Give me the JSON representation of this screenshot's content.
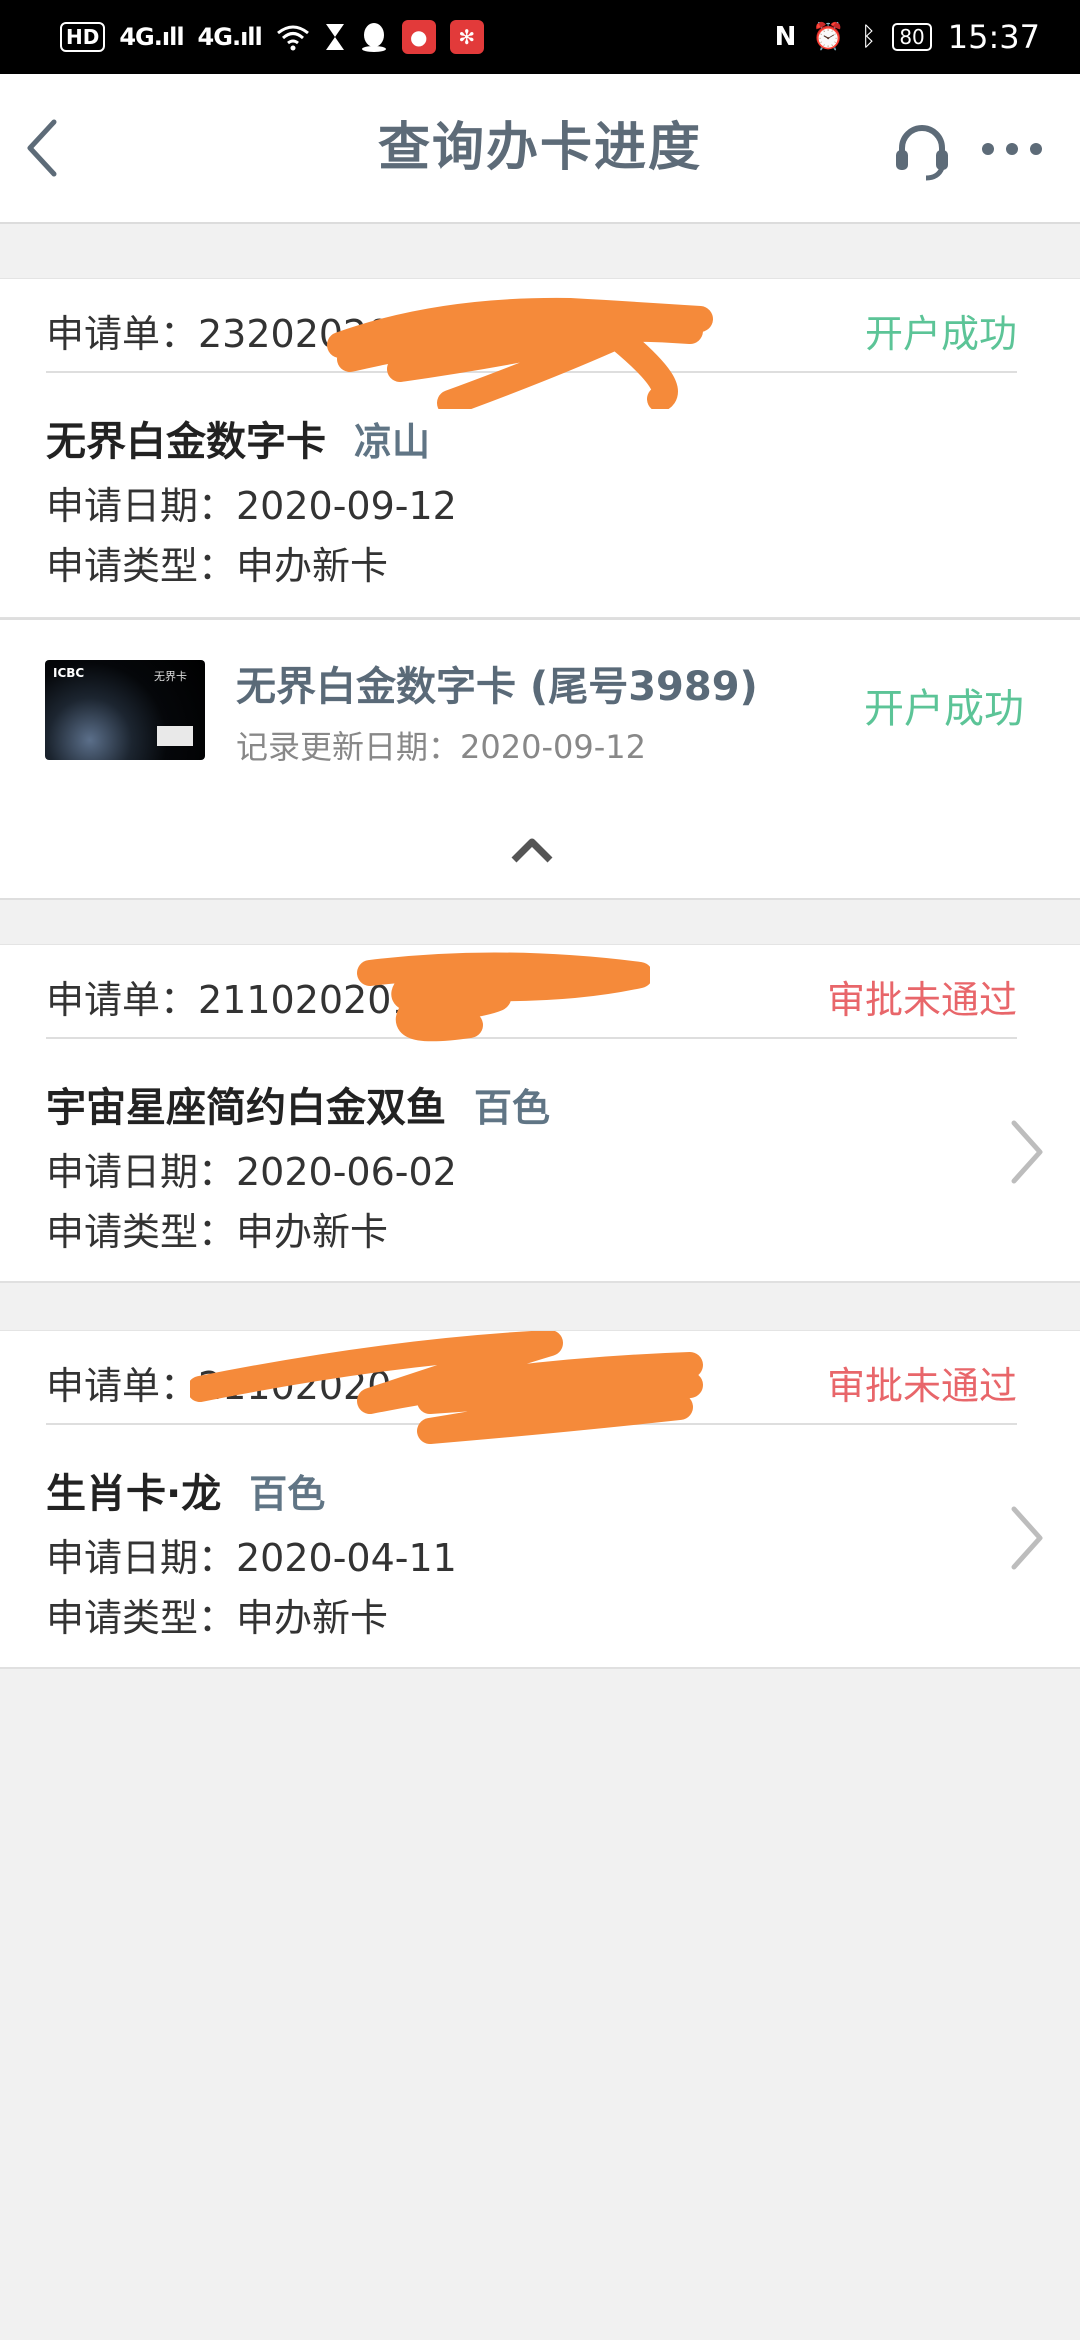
{
  "status_bar": {
    "hd": "HD",
    "sig1": "4G.ıll",
    "sig2": "4G.ıll",
    "battery": "80",
    "time": "15:37"
  },
  "header": {
    "title": "查询办卡进度"
  },
  "applications": [
    {
      "app_no": "申请单：232020200  901",
      "status": "开户成功",
      "card_name": "无界白金数字卡",
      "region": "凉山",
      "date": "申请日期：2020-09-12",
      "type": "申请类型：申办新卡",
      "detail": {
        "title": "无界白金数字卡 (尾号3989)",
        "update": "记录更新日期：2020-09-12",
        "status": "开户成功",
        "thumb_bank": "ICBC",
        "thumb_name": "无界卡"
      }
    },
    {
      "app_no": "申请单：211020201  7",
      "status": "审批未通过",
      "card_name": "宇宙星座简约白金双鱼",
      "region": "百色",
      "date": "申请日期：2020-06-02",
      "type": "申请类型：申办新卡"
    },
    {
      "app_no": "申请单：21102020",
      "status": "审批未通过",
      "card_name": "生肖卡·龙",
      "region": "百色",
      "date": "申请日期：2020-04-11",
      "type": "申请类型：申办新卡"
    }
  ],
  "colors": {
    "success": "#5cc497",
    "fail": "#e8666a",
    "title": "#5d6b78",
    "scribble": "#f58a3a"
  }
}
